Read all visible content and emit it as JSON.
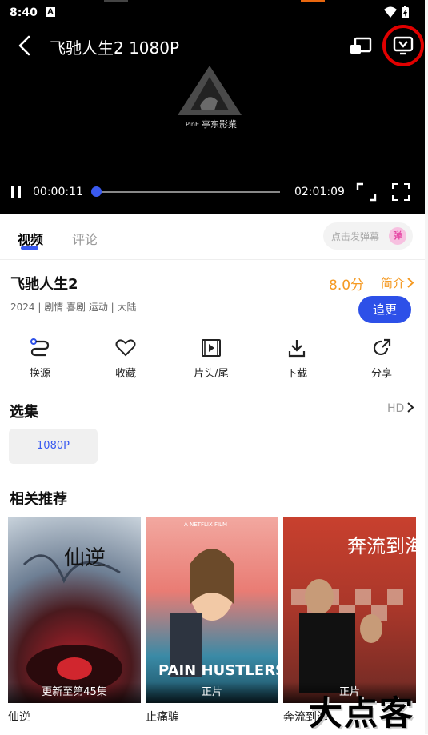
{
  "status_bar": {
    "time": "8:40",
    "a_badge": "A"
  },
  "player": {
    "title": "飞驰人生2  1080P",
    "logo_text": "亭东影業",
    "logo_sub": "PinE",
    "current_time": "00:00:11",
    "total_time": "02:01:09",
    "progress": 0.0015
  },
  "tabs": {
    "video": "视频",
    "comment": "评论"
  },
  "danmu": {
    "placeholder": "点击发弹幕",
    "icon": "弹"
  },
  "movie": {
    "title": "飞驰人生2",
    "meta": "2024 | 剧情 喜剧 运动 | 大陆",
    "score": "8.0分",
    "intro": "简介",
    "follow": "追更"
  },
  "actions": [
    {
      "label": "换源",
      "icon": "switch-source-icon"
    },
    {
      "label": "收藏",
      "icon": "heart-icon"
    },
    {
      "label": "片头/尾",
      "icon": "skip-intro-icon"
    },
    {
      "label": "下载",
      "icon": "download-icon"
    },
    {
      "label": "分享",
      "icon": "share-icon"
    }
  ],
  "episodes": {
    "title": "选集",
    "quality_link": "HD",
    "items": [
      "1080P"
    ]
  },
  "related": {
    "title": "相关推荐",
    "items": [
      {
        "name": "仙逆",
        "badge": "更新至第45集",
        "poster_title": "仙逆"
      },
      {
        "name": "止痛骗",
        "badge": "正片",
        "poster_title": "PAIN HUSTLERS",
        "poster_top": "A NETFLIX FILM"
      },
      {
        "name": "奔流到海",
        "badge": "正片",
        "poster_title": "奔流到海"
      }
    ]
  },
  "watermark": "大点客",
  "colors": {
    "accent": "#2d50e8",
    "score": "#f59a23",
    "highlight": "#e10000"
  }
}
